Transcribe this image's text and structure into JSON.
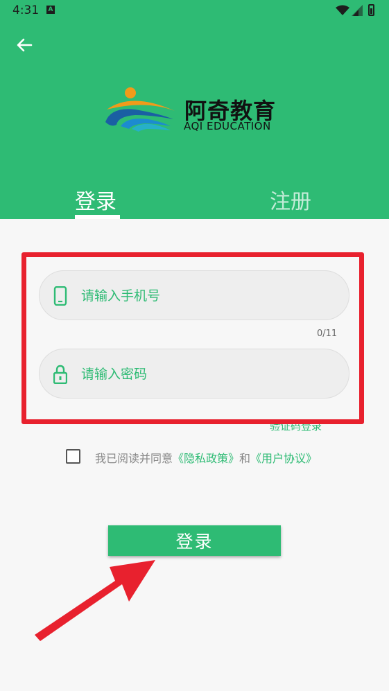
{
  "status_bar": {
    "time": "4:31",
    "notification_icon": "A"
  },
  "header": {
    "back_icon": "arrow-left-icon",
    "logo": {
      "cn": "阿奇教育",
      "en": "AQI EDUCATION"
    }
  },
  "tabs": [
    {
      "label": "登录",
      "active": true
    },
    {
      "label": "注册",
      "active": false
    }
  ],
  "form": {
    "phone_placeholder": "请输入手机号",
    "phone_counter": "0/11",
    "password_placeholder": "请输入密码",
    "sms_login_link": "验证码登录"
  },
  "agreement": {
    "prefix": "我已阅读并同意",
    "privacy_link": "《隐私政策》",
    "conjunction": "和",
    "user_link": "《用户协议》",
    "checked": false
  },
  "login_button": "登录",
  "colors": {
    "brand_green": "#2ebb74",
    "highlight_red": "#e8212e"
  }
}
